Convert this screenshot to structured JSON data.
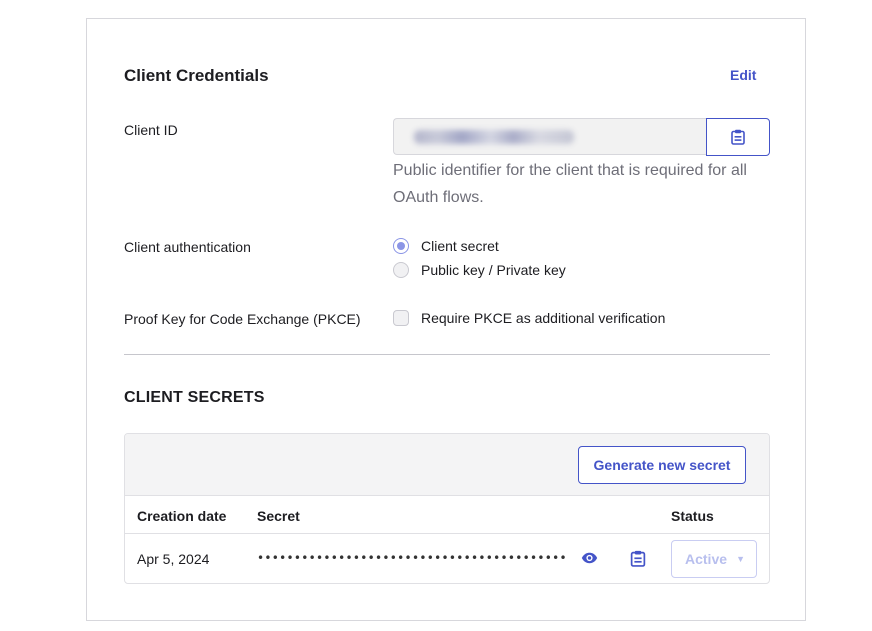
{
  "credentials": {
    "title": "Client Credentials",
    "edit_label": "Edit",
    "client_id": {
      "label": "Client ID",
      "helper": "Public identifier for the client that is required for all OAuth flows."
    },
    "authentication": {
      "label": "Client authentication",
      "options": [
        {
          "label": "Client secret",
          "selected": true
        },
        {
          "label": "Public key / Private key",
          "selected": false
        }
      ]
    },
    "pkce": {
      "label": "Proof Key for Code Exchange (PKCE)",
      "checkbox_label": "Require PKCE as additional verification",
      "checked": false
    }
  },
  "secrets": {
    "title": "CLIENT SECRETS",
    "generate_label": "Generate new secret",
    "columns": [
      "Creation date",
      "Secret",
      "Status"
    ],
    "rows": [
      {
        "creation_date": "Apr 5, 2024",
        "secret_masked": "••••••••••••••••••••••••••••••••••••••••••",
        "status": "Active"
      }
    ]
  },
  "colors": {
    "accent": "#4454c8",
    "radio_selected": "#8b95e6",
    "status_disabled": "#b8bfee"
  },
  "icons": [
    "clipboard-icon",
    "eye-icon",
    "caret-down-icon"
  ]
}
